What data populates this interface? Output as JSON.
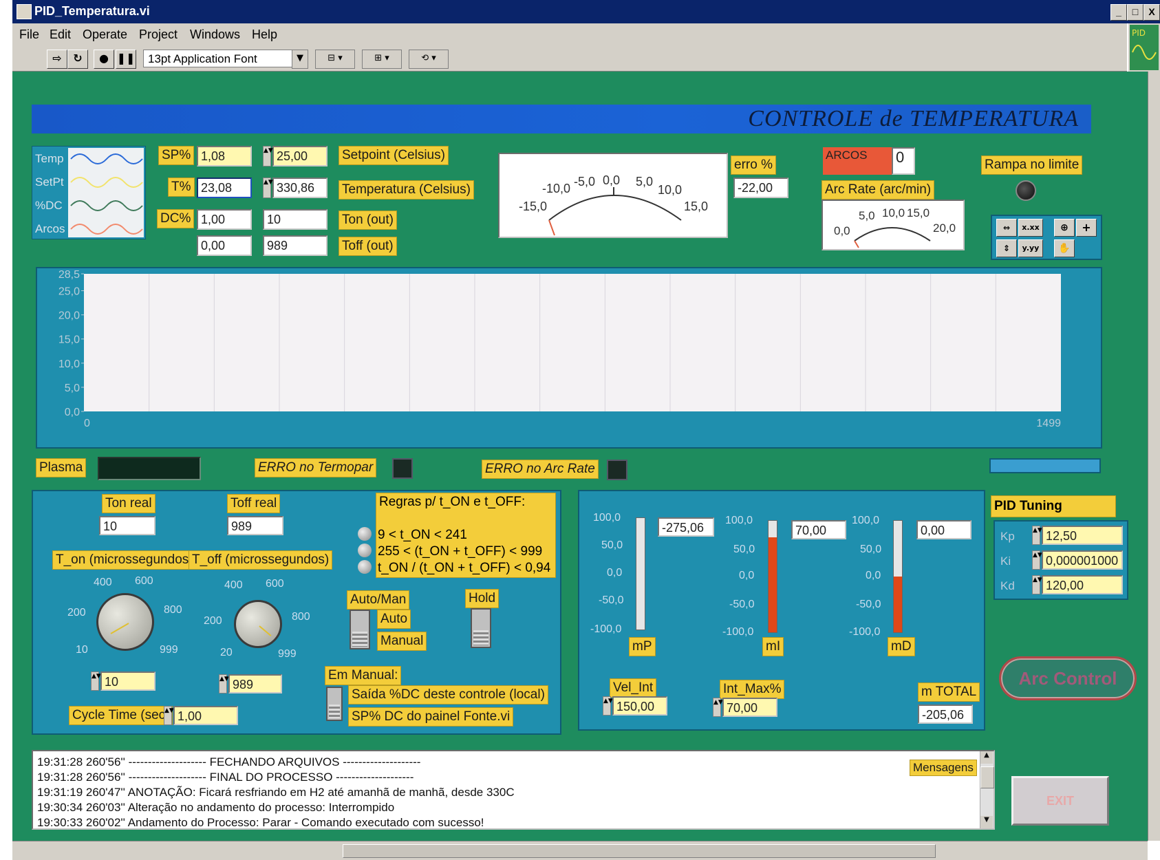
{
  "window": {
    "title": "PID_Temperatura.vi",
    "min": "_",
    "max": "□",
    "close": "X"
  },
  "menu": [
    "File",
    "Edit",
    "Operate",
    "Project",
    "Windows",
    "Help"
  ],
  "toolbar": {
    "font": "13pt Application Font",
    "dd_arrow": "▼"
  },
  "banner": {
    "title": "CONTROLE de TEMPERATURA"
  },
  "legend": [
    "Temp",
    "SetPt",
    "%DC",
    "Arcos"
  ],
  "legend_colors": [
    "#2a6ad8",
    "#f2e36a",
    "#3f7a5a",
    "#f28a6c"
  ],
  "inputs": {
    "sp_label": "SP%",
    "sp_pct": "1,08",
    "sp_celsius": "25,00",
    "setpoint_label": "Setpoint (Celsius)",
    "t_label": "T%",
    "t_pct": "23,08",
    "t_celsius": "330,86",
    "temperature_label": "Temperatura (Celsius)",
    "dc_label": "DC%",
    "dc_pct": "1,00",
    "ton_out": "10",
    "ton_label": "Ton (out)",
    "extra_val": "0,00",
    "toff_out": "989",
    "toff_label": "Toff (out)"
  },
  "error_gauge": {
    "ticks": [
      "-15,0",
      "-10,0",
      "-5,0",
      "0,0",
      "5,0",
      "10,0",
      "15,0"
    ],
    "label": "erro %",
    "value": "-22,00"
  },
  "arcos": {
    "label": "ARCOS",
    "count": "0",
    "rate_label": "Arc Rate (arc/min)",
    "ticks": [
      "0,0",
      "5,0",
      "10,0",
      "15,0",
      "20,0"
    ]
  },
  "rampa": {
    "label": "Rampa no limite"
  },
  "chart_data": {
    "type": "line",
    "y_ticks": [
      "28,5",
      "25,0",
      "20,0",
      "15,0",
      "10,0",
      "5,0",
      "0,0"
    ],
    "x_ticks": [
      "0",
      "1499"
    ],
    "xlim": [
      0,
      1499
    ],
    "ylim": [
      0,
      28.5
    ],
    "grid": true,
    "series": []
  },
  "status": {
    "plasma_label": "Plasma",
    "erro_termopar": "ERRO no Termopar",
    "erro_arcrate": "ERRO no Arc Rate"
  },
  "timing": {
    "ton_real_label": "Ton real",
    "ton_real": "10",
    "toff_real_label": "Toff real",
    "toff_real": "989",
    "ton_micro_label": "T_on (microssegundos)",
    "toff_micro_label": "T_off (microssegundos)",
    "ton_knob_ticks": [
      "400",
      "600",
      "200",
      "800",
      "10",
      "999"
    ],
    "toff_knob_ticks": [
      "400",
      "600",
      "200",
      "800",
      "20",
      "999"
    ],
    "ton_value": "10",
    "toff_value": "989",
    "cycle_label": "Cycle Time (sec)",
    "cycle_value": "1,00"
  },
  "rules": {
    "title": "Regras p/ t_ON e t_OFF:",
    "r1": "9 < t_ON < 241",
    "r2": "255 < (t_ON + t_OFF) < 999",
    "r3": "t_ON / (t_ON + t_OFF) < 0,94"
  },
  "mode": {
    "automan_label": "Auto/Man",
    "auto": "Auto",
    "manual": "Manual",
    "hold": "Hold",
    "em_manual": "Em Manual:",
    "opt1": "Saída %DC deste controle (local)",
    "opt2": "SP% DC do painel Fonte.vi"
  },
  "bars": {
    "mp": {
      "label": "mP",
      "value": "-275,06",
      "ticks": [
        "100,0",
        "50,0",
        "0,0",
        "-50,0",
        "-100,0"
      ],
      "fill": 0.0
    },
    "mi": {
      "label": "mI",
      "value": "70,00",
      "ticks": [
        "100,0",
        "50,0",
        "0,0",
        "-50,0",
        "-100,0"
      ],
      "fill": 0.85
    },
    "md": {
      "label": "mD",
      "value": "0,00",
      "ticks": [
        "100,0",
        "50,0",
        "0,0",
        "-50,0",
        "-100,0"
      ],
      "fill": 0.5
    },
    "vel_int_label": "Vel_Int",
    "vel_int": "150,00",
    "int_max_label": "Int_Max%",
    "int_max": "70,00",
    "mtotal_label": "m TOTAL",
    "mtotal": "-205,06"
  },
  "pid": {
    "title": "PID Tuning",
    "kp_label": "Kp",
    "kp": "12,50",
    "ki_label": "Ki",
    "ki": "0,000001000",
    "kd_label": "Kd",
    "kd": "120,00"
  },
  "buttons": {
    "arc_control": "Arc Control",
    "exit": "EXIT"
  },
  "messages": {
    "label": "Mensagens",
    "lines": [
      "19:31:28  260'56''  -------------------- FECHANDO ARQUIVOS --------------------",
      "19:31:28  260'56''  -------------------- FINAL DO PROCESSO --------------------",
      "19:31:19  260'47''  ANOTAÇÃO: Ficará resfriando em H2 até amanhã de manhã, desde 330C",
      "19:30:34  260'03''  Alteração no andamento do processo:  Interrompido",
      "19:30:33  260'02''  Andamento do Processo: Parar - Comando executado com sucesso!"
    ]
  }
}
